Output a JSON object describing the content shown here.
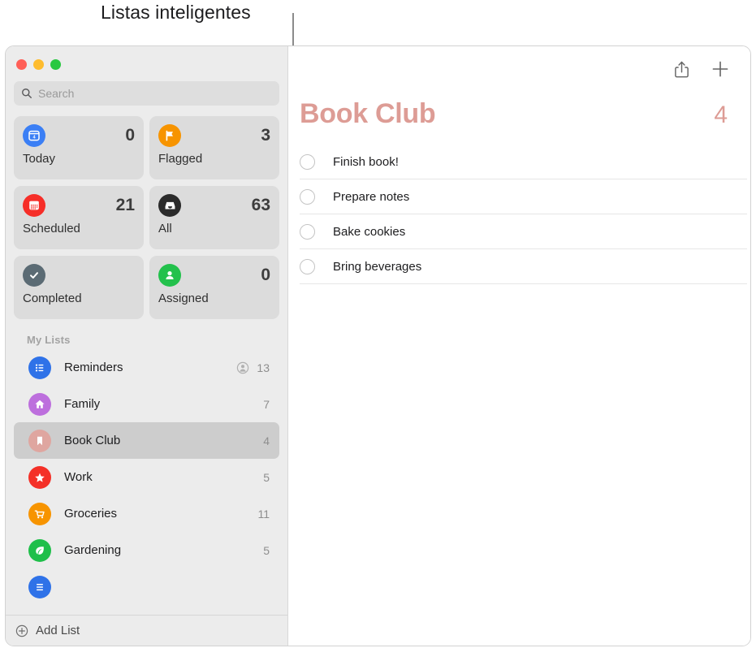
{
  "callout": {
    "label": "Listas inteligentes"
  },
  "window": {
    "traffic_lights": [
      {
        "name": "close",
        "color": "#ff5f57"
      },
      {
        "name": "minimize",
        "color": "#febc2e"
      },
      {
        "name": "zoom",
        "color": "#28c840"
      }
    ]
  },
  "sidebar": {
    "search": {
      "placeholder": "Search",
      "value": ""
    },
    "smart_lists": [
      {
        "id": "today",
        "label": "Today",
        "count": "0",
        "icon": "calendar-day-icon",
        "icon_color": "#3b7ff5",
        "icon_glyph": "4"
      },
      {
        "id": "flagged",
        "label": "Flagged",
        "count": "3",
        "icon": "flag-icon",
        "icon_color": "#f79400"
      },
      {
        "id": "scheduled",
        "label": "Scheduled",
        "count": "21",
        "icon": "calendar-icon",
        "icon_color": "#f62e28"
      },
      {
        "id": "all",
        "label": "All",
        "count": "63",
        "icon": "tray-icon",
        "icon_color": "#2b2b2b"
      },
      {
        "id": "completed",
        "label": "Completed",
        "count": "",
        "icon": "checkmark-icon",
        "icon_color": "#5b6b74"
      },
      {
        "id": "assigned",
        "label": "Assigned",
        "count": "0",
        "icon": "person-icon",
        "icon_color": "#23c councils"
      }
    ],
    "my_lists_header": "My Lists",
    "lists": [
      {
        "name": "Reminders",
        "count": "13",
        "icon": "bulleted-list-icon",
        "icon_color": "#2f72e8",
        "shared": true,
        "selected": false
      },
      {
        "name": "Family",
        "count": "7",
        "icon": "house-icon",
        "icon_color": "#bd6fdd",
        "shared": false,
        "selected": false
      },
      {
        "name": "Book Club",
        "count": "4",
        "icon": "bookmark-icon",
        "icon_color": "#dfa6a0",
        "shared": false,
        "selected": true
      },
      {
        "name": "Work",
        "count": "5",
        "icon": "star-icon",
        "icon_color": "#f43027",
        "shared": false,
        "selected": false
      },
      {
        "name": "Groceries",
        "count": "11",
        "icon": "cart-icon",
        "icon_color": "#f79400",
        "shared": false,
        "selected": false
      },
      {
        "name": "Gardening",
        "count": "5",
        "icon": "leaf-icon",
        "icon_color": "#1fbf4a",
        "shared": false,
        "selected": false
      },
      {
        "name": "",
        "count": "",
        "icon": "list-icon",
        "icon_color": "#2f72e8",
        "shared": false,
        "selected": false
      }
    ],
    "add_list": {
      "label": "Add List",
      "icon": "plus-circle-icon"
    }
  },
  "main": {
    "toolbar": [
      {
        "name": "share-icon",
        "label": "Share"
      },
      {
        "name": "plus-icon",
        "label": "Add Reminder"
      }
    ],
    "title": "Book Club",
    "count": "4",
    "accent_color": "#dd9c95",
    "reminders": [
      {
        "text": "Finish book!",
        "completed": false
      },
      {
        "text": "Prepare notes",
        "completed": false
      },
      {
        "text": "Bake cookies",
        "completed": false
      },
      {
        "text": "Bring beverages",
        "completed": false
      }
    ]
  }
}
